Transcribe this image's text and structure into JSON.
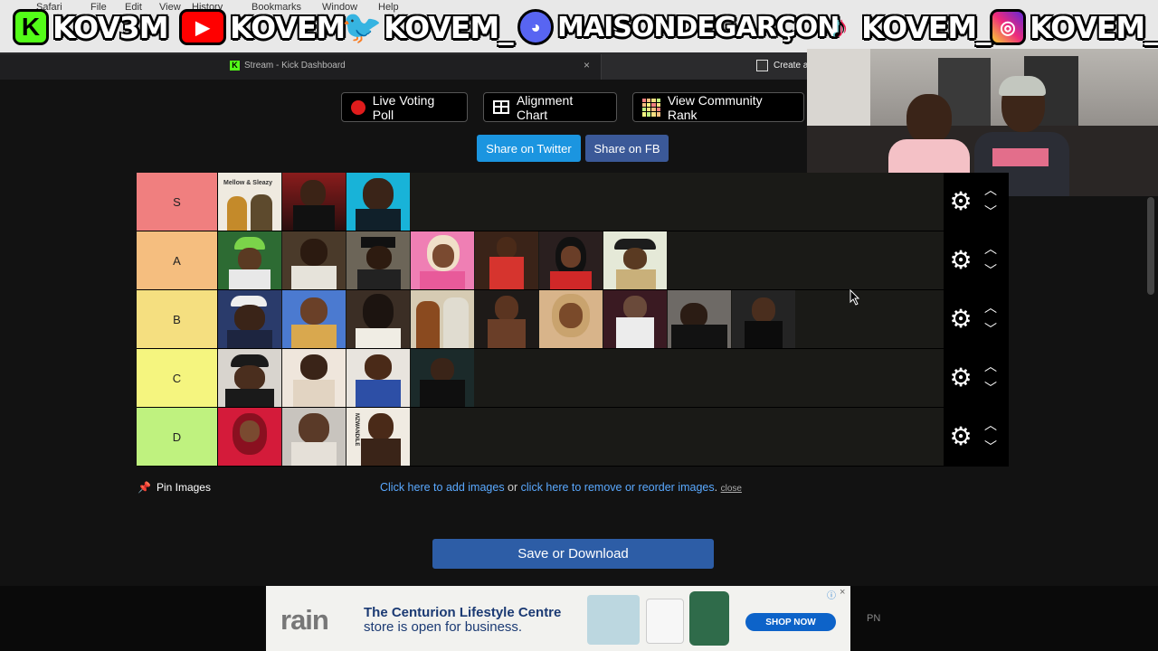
{
  "menubar": [
    "Safari",
    "File",
    "Edit",
    "View",
    "History",
    "Bookmarks",
    "Window",
    "Help"
  ],
  "overlay": {
    "kick_handle": "KOV3M",
    "youtube_handle": "KOVEM",
    "twitter_handle": "KOVEM_",
    "discord_handle": "MAISONDEGARÇON",
    "tiktok_handle": "KOVEM_",
    "instagram_handle": "KOVEM_"
  },
  "browser": {
    "tab_title": "Stream - Kick Dashboard",
    "tab_close": "×",
    "tab2_title": "Create a"
  },
  "toolbar": {
    "poll_label": "Live Voting Poll",
    "alignment_label": "Alignment Chart",
    "rank_label": "View Community Rank",
    "share_twitter": "Share on Twitter",
    "share_fb": "Share on FB"
  },
  "tiers": [
    {
      "label": "S",
      "color": "#f07f7f",
      "count": 3
    },
    {
      "label": "A",
      "color": "#f5be7f",
      "count": 7
    },
    {
      "label": "B",
      "color": "#f5df80",
      "count": 9
    },
    {
      "label": "C",
      "color": "#f5f57f",
      "count": 4
    },
    {
      "label": "D",
      "color": "#bff27f",
      "count": 3
    }
  ],
  "tile_art": {
    "S": [
      "Mellow & Sleazy"
    ],
    "D": [
      "MZWANDILE"
    ]
  },
  "pin_label": "Pin Images",
  "help": {
    "add_link": "Click here to add images",
    "or": " or ",
    "remove_link": "click here to remove or reorder images",
    "period": ".",
    "close": "close"
  },
  "save_label": "Save or Download",
  "ad": {
    "brand": "rain",
    "headline": "The Centurion Lifestyle Centre",
    "subline": "store is open for business.",
    "cta": "SHOP NOW",
    "info": "ⓘ",
    "close": "×"
  },
  "corner_text": "PN"
}
